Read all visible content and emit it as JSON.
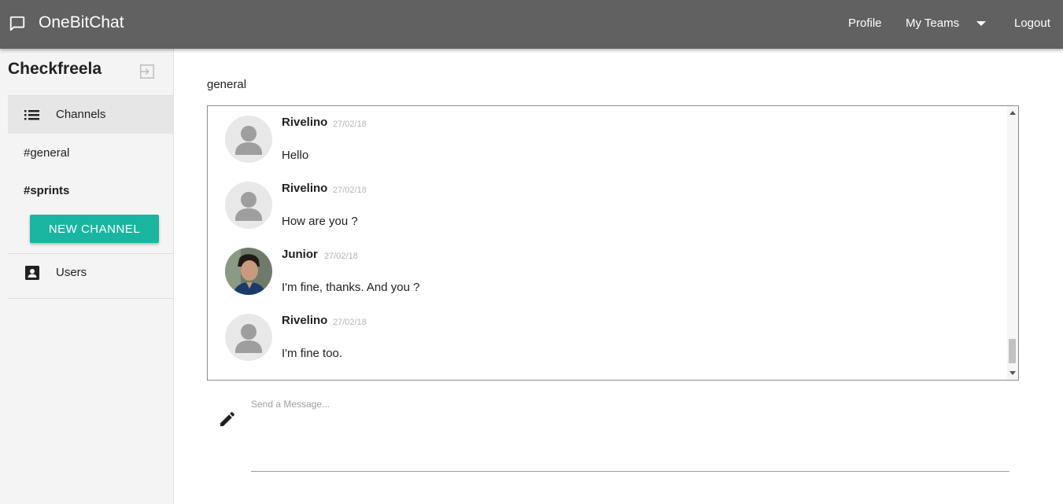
{
  "app": {
    "title": "OneBitChat"
  },
  "nav": {
    "profile": "Profile",
    "teams": "My Teams",
    "logout": "Logout"
  },
  "sidebar": {
    "team_name": "Checkfreela",
    "channels_label": "Channels",
    "channels": [
      {
        "name": "#general",
        "bold": false
      },
      {
        "name": "#sprints",
        "bold": true
      }
    ],
    "new_channel_label": "NEW CHANNEL",
    "users_label": "Users"
  },
  "main": {
    "channel_title": "general",
    "messages": [
      {
        "author": "Rivelino",
        "date": "27/02/18",
        "text": "Hello",
        "avatar": "default-avatar"
      },
      {
        "author": "Rivelino",
        "date": "27/02/18",
        "text": "How are you ?",
        "avatar": "default-avatar"
      },
      {
        "author": "Junior",
        "date": "27/02/18",
        "text": "I'm fine, thanks. And you ?",
        "avatar": "photo-avatar"
      },
      {
        "author": "Rivelino",
        "date": "27/02/18",
        "text": "I'm fine too.",
        "avatar": "default-avatar"
      }
    ],
    "input_placeholder": "Send a Message..."
  },
  "colors": {
    "topbar": "#616161",
    "accent": "#1ab5a0",
    "sidebar_bg": "#f4f4f4"
  }
}
